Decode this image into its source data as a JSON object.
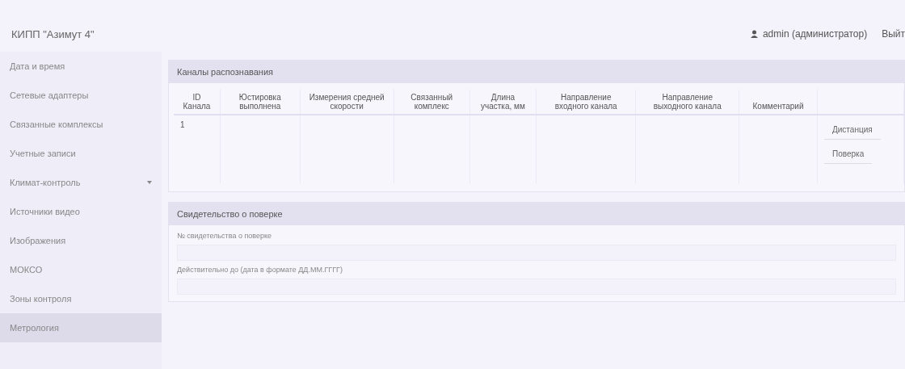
{
  "header": {
    "title": "КИПП \"Азимут 4\"",
    "user": "admin (администратор)",
    "logout": "Выйт"
  },
  "sidebar": {
    "items": [
      {
        "label": "Дата и время",
        "selected": false
      },
      {
        "label": "Сетевые адаптеры",
        "selected": false
      },
      {
        "label": "Связанные комплексы",
        "selected": false
      },
      {
        "label": "Учетные записи",
        "selected": false
      },
      {
        "label": "Климат-контроль",
        "selected": false,
        "caret": true
      },
      {
        "label": "Источники видео",
        "selected": false
      },
      {
        "label": "Изображения",
        "selected": false
      },
      {
        "label": "МОКСО",
        "selected": false
      },
      {
        "label": "Зоны контроля",
        "selected": false
      },
      {
        "label": "Метрология",
        "selected": true
      }
    ]
  },
  "channels": {
    "title": "Каналы распознавания",
    "columns": [
      "ID Канала",
      "Юстировка выполнена",
      "Измерения средней скорости",
      "Связанный комплекс",
      "Длина участка, мм",
      "Направление входного канала",
      "Направление выходного канала",
      "Комментарий"
    ],
    "rows": [
      {
        "id": "1",
        "actions": [
          "Дистанция",
          "Поверка"
        ]
      }
    ]
  },
  "certificate": {
    "title": "Свидетельство о поверке",
    "fields": [
      {
        "label": "№ свидетельства о поверке"
      },
      {
        "label": "Действительно до (дата в формате ДД.ММ.ГГГГ)"
      }
    ]
  }
}
